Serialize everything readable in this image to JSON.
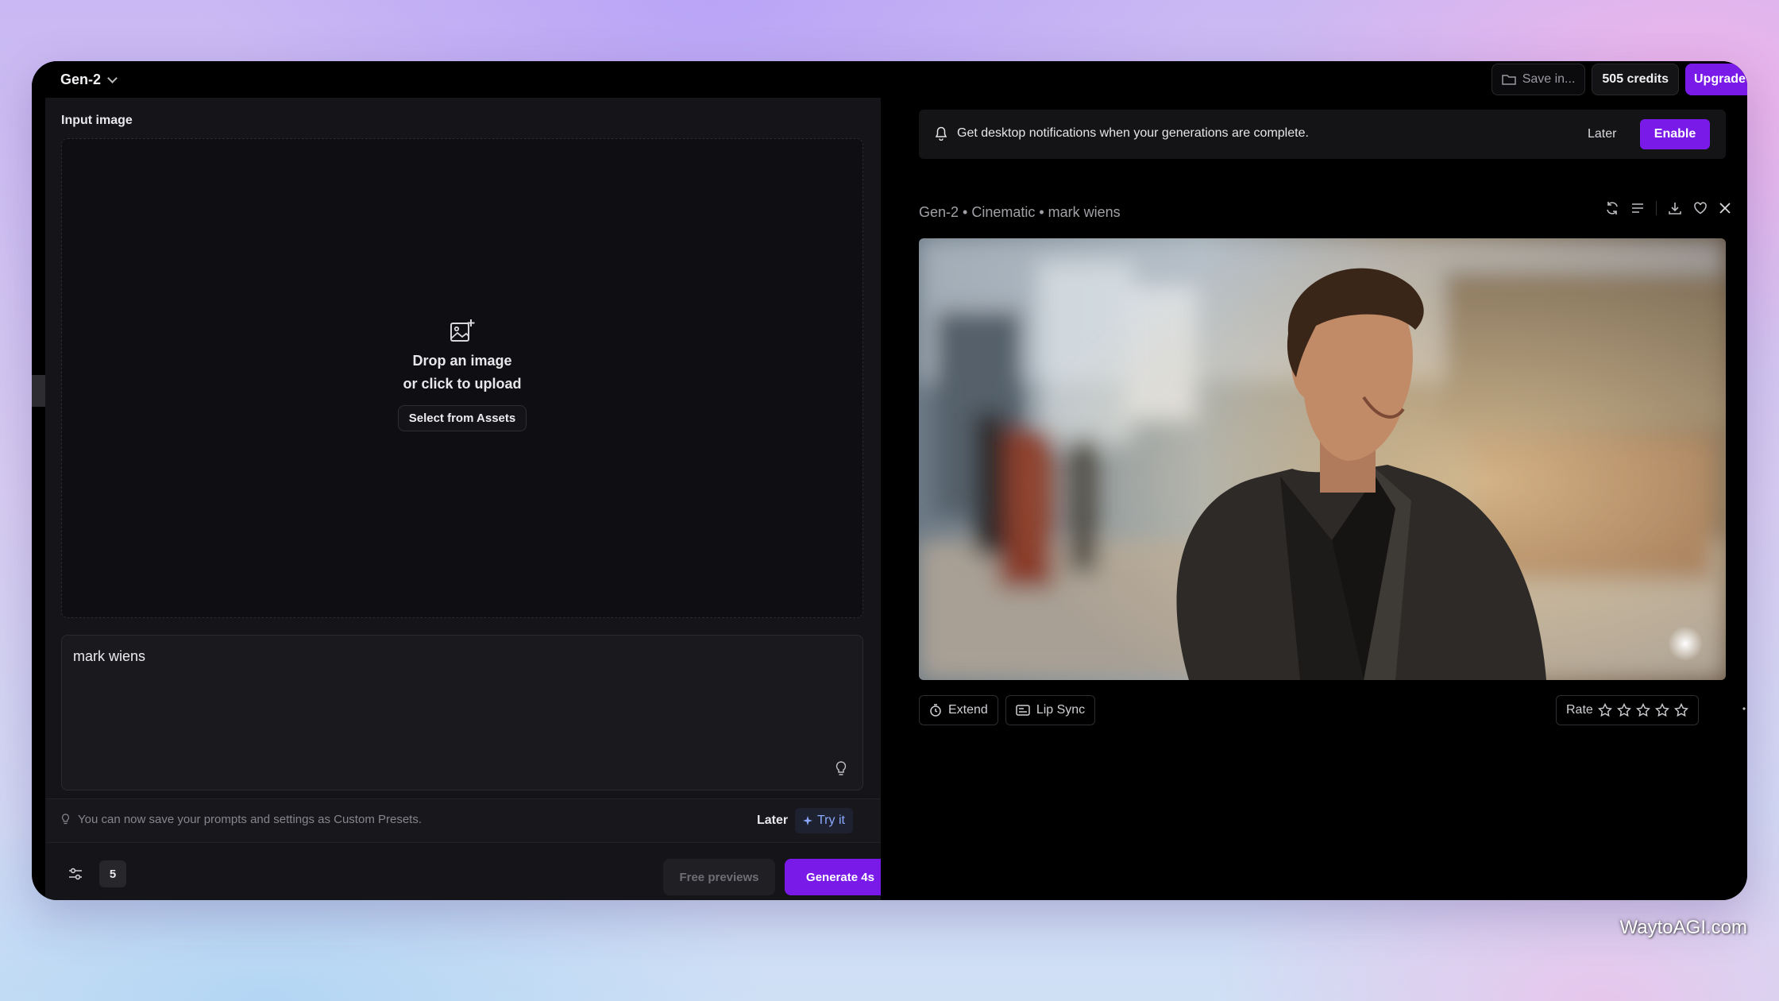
{
  "topbar": {
    "model": "Gen-2",
    "save_in": "Save in...",
    "credits": "505 credits",
    "upgrade": "Upgrade"
  },
  "left": {
    "input_label": "Input image",
    "drop_line1": "Drop an image",
    "drop_line2": "or click to upload",
    "select_assets": "Select from Assets",
    "prompt": "mark wiens",
    "preset_notice": "You can now save your prompts and settings as Custom Presets.",
    "preset_later": "Later",
    "preset_try": "Try it",
    "duration": "5",
    "free_previews": "Free previews",
    "generate": "Generate 4s"
  },
  "right": {
    "notification": "Get desktop notifications when your generations are complete.",
    "notif_later": "Later",
    "notif_enable": "Enable",
    "generation_meta": "Gen-2 • Cinematic • mark wiens",
    "extend": "Extend",
    "lip_sync": "Lip Sync",
    "rate": "Rate",
    "rating_stars": 0
  },
  "watermark": "WaytoAGI.com",
  "colors": {
    "accent": "#7a1ae8",
    "panel": "#151519",
    "background": "#000000"
  },
  "icons": [
    "chevron-down-icon",
    "folder-icon",
    "add-image-icon",
    "lightbulb-icon",
    "sliders-icon",
    "bell-icon",
    "refresh-icon",
    "list-icon",
    "download-icon",
    "heart-icon",
    "close-icon",
    "extend-icon",
    "lip-sync-icon",
    "star-icon",
    "more-icon"
  ]
}
